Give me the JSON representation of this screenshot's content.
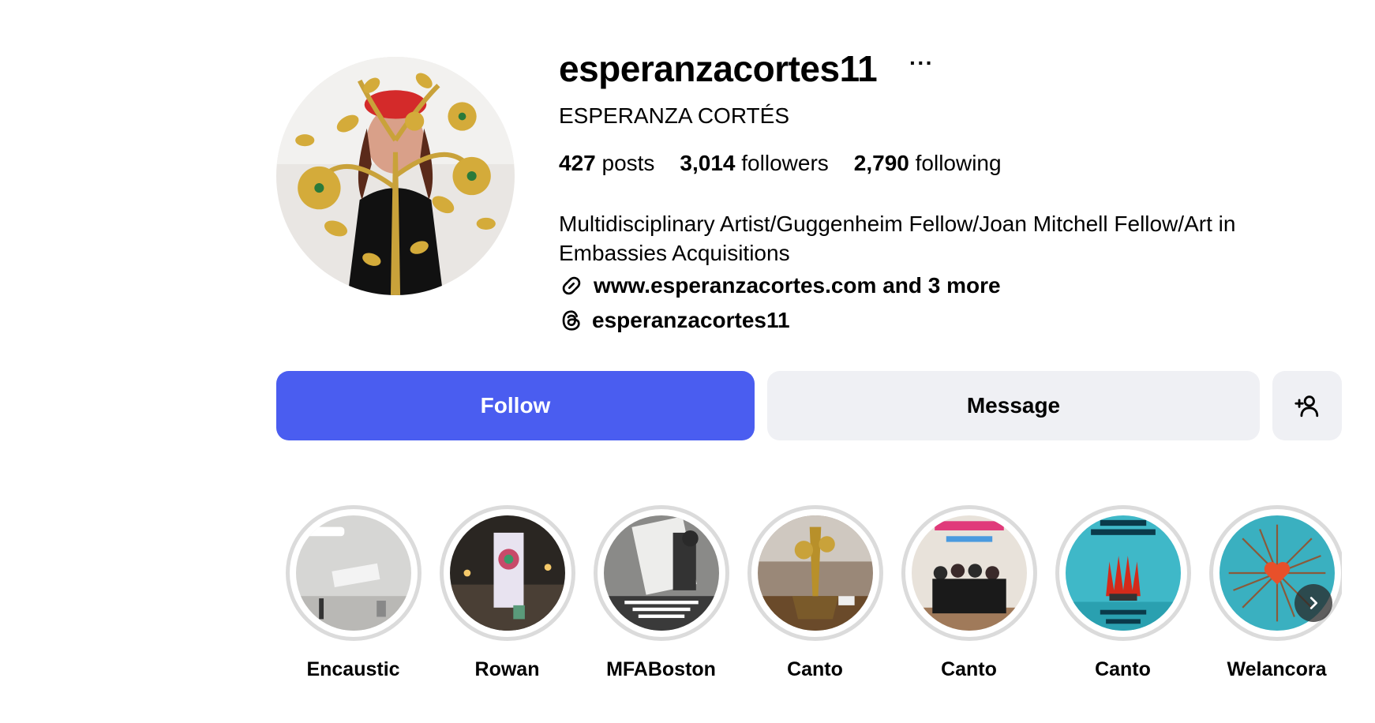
{
  "profile": {
    "username": "esperanzacortes11",
    "more_icon": "···",
    "full_name": "ESPERANZA CORTÉS",
    "stats": {
      "posts_count": "427",
      "posts_label": " posts",
      "followers_count": "3,014",
      "followers_label": " followers",
      "following_count": "2,790",
      "following_label": " following"
    },
    "bio": "Multidisciplinary Artist/Guggenheim Fellow/Joan Mitchell Fellow/Art in Embassies Acquisitions",
    "link_text": "www.esperanzacortes.com and 3 more",
    "threads_handle": "esperanzacortes11"
  },
  "actions": {
    "follow_label": "Follow",
    "message_label": "Message"
  },
  "highlights": [
    {
      "label": "Encaustic"
    },
    {
      "label": "Rowan"
    },
    {
      "label": "MFABoston"
    },
    {
      "label": "Canto"
    },
    {
      "label": "Canto"
    },
    {
      "label": "Canto"
    },
    {
      "label": "Welancora"
    }
  ],
  "colors": {
    "follow_button": "#4a5df0",
    "secondary_button": "#eff0f4",
    "highlight_ring": "#dbdbdb"
  },
  "icons": {
    "link": "link-icon",
    "threads": "threads-icon",
    "add_user": "add-user-icon",
    "next": "chevron-right-icon"
  }
}
